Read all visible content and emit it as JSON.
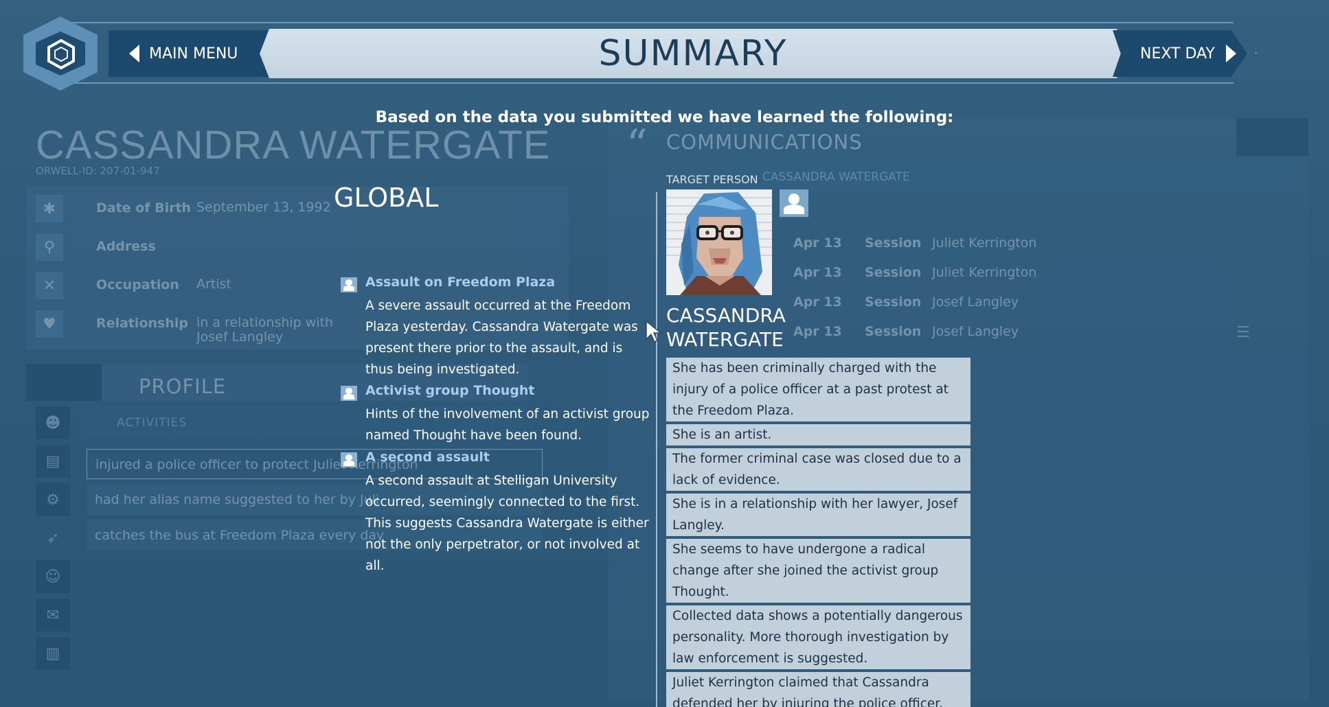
{
  "header": {
    "main_menu_label": "MAIN MENU",
    "title": "SUMMARY",
    "next_day_label": "NEXT DAY"
  },
  "subtitle": "Based on the data you submitted we have learned the following:",
  "global": {
    "title": "GLOBAL",
    "items": [
      {
        "title": "Assault on Freedom Plaza",
        "text": "A severe assault occurred at the Freedom Plaza yesterday. Cassandra Watergate was present there prior to the assault, and is thus being investigated."
      },
      {
        "title": "Activist group Thought",
        "text": "Hints of the involvement of an activist group named Thought have been found."
      },
      {
        "title": "A second assault",
        "text": "A second assault at Stelligan University occurred, seemingly connected to the first. This suggests Cassandra Watergate is either not the only perpetrator, or not involved at all."
      }
    ]
  },
  "target": {
    "label": "TARGET PERSON",
    "name_line1": "CASSANDRA",
    "name_line2": "WATERGATE",
    "facts": [
      "She has been criminally charged with the injury of a police officer at a past protest at the Freedom Plaza.",
      "She is an artist.",
      "The former criminal case was closed due to a lack of evidence.",
      "She is in a relationship with her lawyer, Josef Langley.",
      "She seems to have undergone a radical change after she joined the activist group Thought.",
      "Collected data shows a potentially dangerous personality. More thorough investigation by law enforcement is suggested.",
      "Juliet Kerrington claimed that Cassandra defended her by injuring the police officer."
    ]
  },
  "background": {
    "name": "CASSANDRA WATERGATE",
    "orwell_id": "ORWELL-ID: 207-01-947",
    "fields": [
      {
        "label": "Date of Birth",
        "value": "September 13, 1992",
        "icon": "asterisk-icon"
      },
      {
        "label": "Address",
        "value": "",
        "icon": "location-pin-icon"
      },
      {
        "label": "Occupation",
        "value": "Artist",
        "icon": "tools-icon"
      },
      {
        "label": "Relationship",
        "value": "in a relationship with Josef Langley",
        "icon": "heart-icon"
      }
    ],
    "profile_title": "PROFILE",
    "activities_label": "ACTIVITIES",
    "activities": [
      "injured a police officer to protect Juliet Kerrington",
      "had her alias name suggested to her by Juli",
      "catches the bus at Freedom Plaza every day"
    ],
    "communications_title": "COMMUNICATIONS",
    "communications_target": "CASSANDRA WATERGATE",
    "sessions": [
      {
        "date": "Apr 13",
        "type": "Session",
        "person": "Juliet Kerrington"
      },
      {
        "date": "Apr 13",
        "type": "Session",
        "person": "Juliet Kerrington"
      },
      {
        "date": "Apr 13",
        "type": "Session",
        "person": "Josef Langley"
      },
      {
        "date": "Apr 13",
        "type": "Session",
        "person": "Josef Langley"
      }
    ]
  },
  "colors": {
    "background": "#2f5a7b",
    "header_dark": "#1b4a6e",
    "summary_bar": "#c8d7e3",
    "fact_bg": "#c2d0dc",
    "item_title": "#a9cdeb"
  }
}
